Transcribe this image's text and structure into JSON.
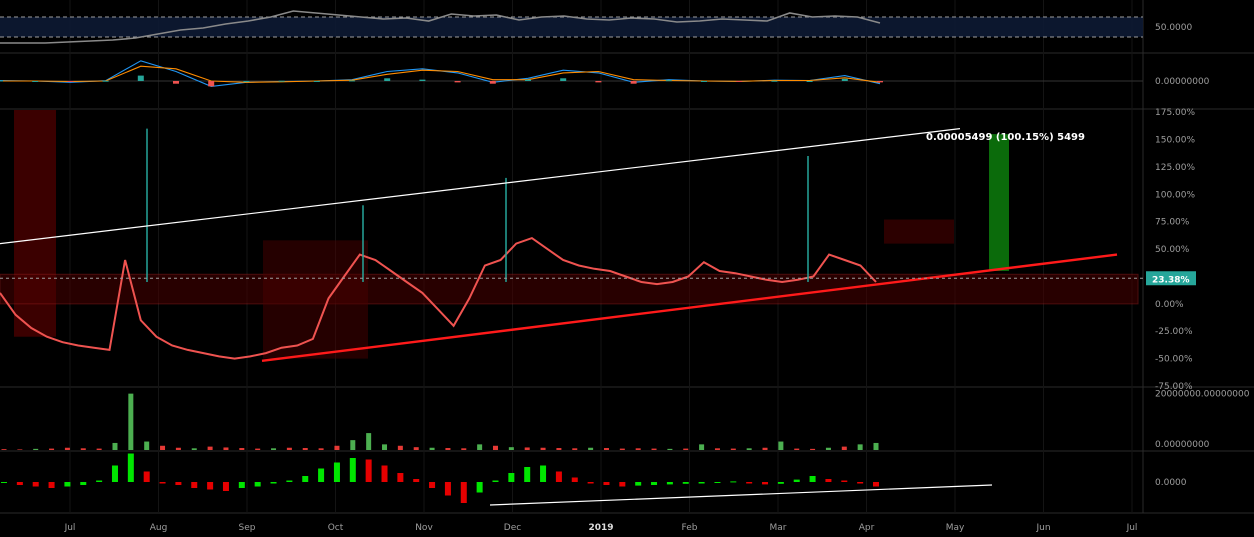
{
  "colors": {
    "background": "#000000",
    "up": "#26a69a",
    "down": "#ef5350",
    "volume_up": "#4caf50",
    "volume_down": "#e53935",
    "trend_red": "#ff1a1a",
    "trend_white": "#ffffff",
    "macd_line": "#2196f3",
    "signal_line": "#ff8c00",
    "hist_green": "#00e600",
    "hist_red": "#e60000",
    "rsi_line": "#8a8a8a",
    "cloud_red": "#4a0000",
    "target_box": "#0b6b0b",
    "current_badge": "#26a69a"
  },
  "chart_data": [
    {
      "type": "line",
      "pane": "rsi",
      "y_tick_labels": [
        "50.0000"
      ],
      "ylim": [
        0,
        100
      ],
      "guide_levels": [
        30,
        70
      ],
      "series": [
        {
          "values": [
            18,
            18,
            18,
            20,
            22,
            24,
            28,
            36,
            44,
            48,
            56,
            62,
            70,
            82,
            78,
            74,
            70,
            66,
            68,
            62,
            76,
            72,
            74,
            64,
            70,
            72,
            66,
            64,
            68,
            66,
            60,
            62,
            66,
            64,
            62,
            78,
            70,
            72,
            70,
            58
          ]
        }
      ]
    },
    {
      "type": "line",
      "pane": "macd",
      "y_tick_labels": [
        "0.00000000"
      ],
      "ylim": [
        -1,
        1
      ],
      "series": [
        {
          "values": [
            0.02,
            0.0,
            -0.05,
            0.01,
            0.75,
            0.35,
            -0.2,
            -0.05,
            -0.02,
            0.0,
            0.05,
            0.35,
            0.45,
            0.3,
            -0.05,
            0.1,
            0.4,
            0.3,
            -0.05,
            0.05,
            0.0,
            -0.02,
            0.03,
            0.02,
            0.2,
            -0.1
          ]
        },
        {
          "values": [
            0.0,
            0.0,
            -0.02,
            0.0,
            0.55,
            0.45,
            0.0,
            -0.05,
            -0.03,
            0.0,
            0.03,
            0.25,
            0.4,
            0.35,
            0.05,
            0.05,
            0.3,
            0.35,
            0.05,
            0.02,
            0.0,
            -0.01,
            0.02,
            0.02,
            0.12,
            -0.05
          ]
        }
      ]
    },
    {
      "type": "line",
      "pane": "price",
      "y_tick_labels": [
        "175.00%",
        "150.00%",
        "125.00%",
        "100.00%",
        "75.00%",
        "50.00%",
        "25.00%",
        "0.00%",
        "-25.00%",
        "-50.00%",
        "-75.00%"
      ],
      "ylim": [
        -75,
        177
      ],
      "x_tick_labels": [
        "Jul",
        "Aug",
        "Sep",
        "Oct",
        "Nov",
        "Dec",
        "2019",
        "Feb",
        "Mar",
        "Apr",
        "May",
        "Jun",
        "Jul"
      ],
      "current_value_label": "23.38%",
      "measurement_label": "0.00005499 (100.15%) 5499",
      "series": [
        {
          "values": [
            10,
            -10,
            -22,
            -30,
            -35,
            -38,
            -40,
            -42,
            40,
            -15,
            -30,
            -38,
            -42,
            -45,
            -48,
            -50,
            -48,
            -45,
            -40,
            -38,
            -32,
            5,
            25,
            45,
            40,
            30,
            20,
            10,
            -5,
            -20,
            5,
            35,
            40,
            55,
            60,
            50,
            40,
            35,
            32,
            30,
            25,
            20,
            18,
            20,
            25,
            38,
            30,
            28,
            25,
            22,
            20,
            22,
            25,
            45,
            40,
            35,
            20
          ]
        }
      ],
      "annotations": [
        {
          "kind": "trendline-white",
          "from": [
            -12,
            55
          ],
          "to": [
            87,
            160
          ]
        },
        {
          "kind": "trendline-red",
          "from": [
            8,
            -52
          ],
          "to": [
            94,
            45
          ]
        },
        {
          "kind": "target-box",
          "x_range": [
            76.5,
            78.5
          ],
          "y_range": [
            30,
            155
          ]
        }
      ]
    },
    {
      "type": "bar",
      "pane": "volume",
      "y_tick_labels": [
        "20000000.00000000",
        "0.00000000"
      ],
      "ylim": [
        0,
        22000000
      ],
      "series": [
        {
          "values": [
            300000,
            200000,
            400000,
            500000,
            800000,
            600000,
            500000,
            2500000,
            20000000,
            3000000,
            1500000,
            800000,
            600000,
            1200000,
            900000,
            700000,
            500000,
            600000,
            800000,
            700000,
            600000,
            1500000,
            3500000,
            6000000,
            2000000,
            1500000,
            1000000,
            800000,
            700000,
            600000,
            2000000,
            1500000,
            1000000,
            900000,
            800000,
            700000,
            600000,
            800000,
            700000,
            500000,
            600000,
            500000,
            400000,
            500000,
            2000000,
            600000,
            500000,
            600000,
            800000,
            3000000,
            500000,
            400000,
            800000,
            1200000,
            2000000,
            2500000
          ]
        }
      ]
    },
    {
      "type": "bar",
      "pane": "oscillator",
      "y_tick_labels": [
        "0.0000"
      ],
      "ylim": [
        -1,
        1
      ],
      "series": [
        {
          "values": [
            0,
            -0.1,
            -0.15,
            -0.2,
            -0.15,
            -0.1,
            0.05,
            0.55,
            0.95,
            0.35,
            -0.05,
            -0.1,
            -0.2,
            -0.25,
            -0.3,
            -0.2,
            -0.15,
            -0.05,
            0.05,
            0.2,
            0.45,
            0.65,
            0.8,
            0.75,
            0.55,
            0.3,
            0.1,
            -0.2,
            -0.45,
            -0.7,
            -0.35,
            0.05,
            0.3,
            0.5,
            0.55,
            0.35,
            0.15,
            -0.05,
            -0.1,
            -0.15,
            -0.12,
            -0.1,
            -0.08,
            -0.06,
            -0.05,
            -0.02,
            0.02,
            -0.05,
            -0.08,
            -0.06,
            0.08,
            0.2,
            0.1,
            0.05,
            -0.05,
            -0.15
          ]
        }
      ]
    }
  ]
}
